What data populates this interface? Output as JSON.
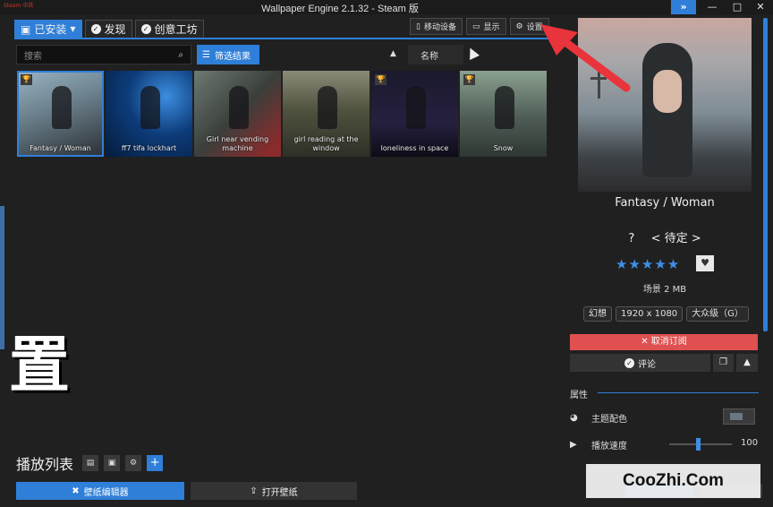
{
  "window": {
    "steam_label": "Steam 中英",
    "title": "Wallpaper Engine 2.1.32 - Steam 版"
  },
  "tabs": [
    {
      "label": "已安装",
      "active": true
    },
    {
      "label": "发现"
    },
    {
      "label": "创意工坊"
    }
  ],
  "top_buttons": {
    "mobile": "移动设备",
    "display": "显示",
    "settings": "设置"
  },
  "search": {
    "placeholder": "搜索"
  },
  "filter": {
    "label": "筛选结果"
  },
  "sort": {
    "label": "名称"
  },
  "wallpapers": [
    {
      "title": "Fantasy / Woman",
      "trophy": true,
      "selected": true
    },
    {
      "title": "ff7 tifa lockhart"
    },
    {
      "title": "Girl near vending machine"
    },
    {
      "title": "girl reading at the window"
    },
    {
      "title": "loneliness in space",
      "trophy": true
    },
    {
      "title": "Snow",
      "trophy": true
    }
  ],
  "overlay_char": "置",
  "playlist": {
    "label": "播放列表"
  },
  "bottom": {
    "editor": "壁纸编辑器",
    "open": "打开壁纸"
  },
  "detail": {
    "title": "Fantasy / Woman",
    "rating_prefix": "?",
    "rating_text": "< 待定 >",
    "stars": "★★★★★",
    "meta": "场景 2 MB",
    "tags": [
      "幻想",
      "1920 x 1080",
      "大众级（G）"
    ],
    "unsubscribe": "取消订阅",
    "comment": "评论"
  },
  "properties": {
    "header": "属性",
    "theme_color": "主题配色",
    "playback_speed": "播放速度",
    "playback_value": "100"
  },
  "watermark": "CooZhi.Com",
  "colors": {
    "accent": "#2f7fd8",
    "danger": "#e05050",
    "arrow": "#e8343a"
  }
}
